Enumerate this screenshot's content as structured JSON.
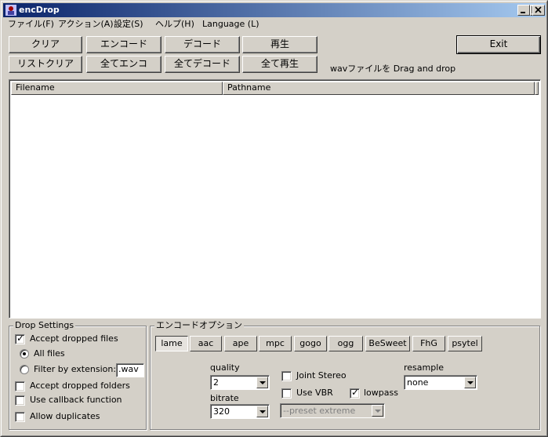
{
  "window": {
    "title": "encDrop"
  },
  "menu": [
    "ファイル(F)",
    "アクション(A)",
    "設定(S)",
    "ヘルプ(H)",
    "Language (L)"
  ],
  "toolbar": {
    "clear": "クリア",
    "encode": "エンコード",
    "decode": "デコード",
    "play": "再生",
    "list_clear": "リストクリア",
    "encode_all": "全てエンコ",
    "decode_all": "全てデコード",
    "play_all": "全て再生",
    "exit": "Exit",
    "hint": "wavファイルを Drag and drop"
  },
  "list": {
    "columns": [
      "Filename",
      "Pathname"
    ],
    "rows": []
  },
  "drop_settings": {
    "title": "Drop Settings",
    "accept_dropped_files": "Accept dropped files",
    "all_files": "All files",
    "filter_by_extension": "Filter by extension:",
    "extension_value": ".wav",
    "accept_dropped_folders": "Accept dropped folders",
    "use_callback": "Use callback function",
    "allow_duplicates": "Allow duplicates"
  },
  "encode_options": {
    "title": "エンコードオプション",
    "encoders": [
      "lame",
      "aac",
      "ape",
      "mpc",
      "gogo",
      "ogg",
      "BeSweet",
      "FhG",
      "psytel"
    ],
    "selected_encoder": "lame",
    "quality_label": "quality",
    "quality_value": "2",
    "bitrate_label": "bitrate",
    "bitrate_value": "320",
    "joint_stereo": "Joint Stereo",
    "use_vbr": "Use VBR",
    "lowpass": "lowpass",
    "preset_value": "--preset extreme",
    "resample_label": "resample",
    "resample_value": "none"
  }
}
